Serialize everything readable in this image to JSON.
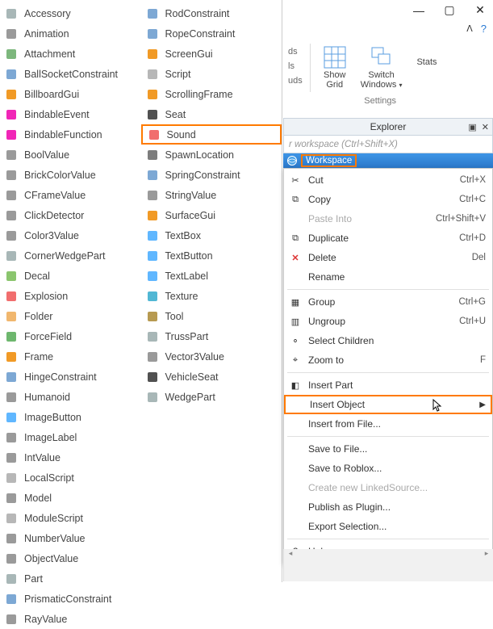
{
  "insert_objects_col1": [
    {
      "label": "Accessory",
      "icon": "#9aa"
    },
    {
      "label": "Animation",
      "icon": "#888"
    },
    {
      "label": "Attachment",
      "icon": "#6a6"
    },
    {
      "label": "BallSocketConstraint",
      "icon": "#69c"
    },
    {
      "label": "BillboardGui",
      "icon": "#e80"
    },
    {
      "label": "BindableEvent",
      "icon": "#e0a"
    },
    {
      "label": "BindableFunction",
      "icon": "#e0a"
    },
    {
      "label": "BoolValue",
      "icon": "#888"
    },
    {
      "label": "BrickColorValue",
      "icon": "#888"
    },
    {
      "label": "CFrameValue",
      "icon": "#888"
    },
    {
      "label": "ClickDetector",
      "icon": "#888"
    },
    {
      "label": "Color3Value",
      "icon": "#888"
    },
    {
      "label": "CornerWedgePart",
      "icon": "#9aa"
    },
    {
      "label": "Decal",
      "icon": "#7b5"
    },
    {
      "label": "Explosion",
      "icon": "#e55"
    },
    {
      "label": "Folder",
      "icon": "#ea5"
    },
    {
      "label": "ForceField",
      "icon": "#5a5"
    },
    {
      "label": "Frame",
      "icon": "#e80"
    },
    {
      "label": "HingeConstraint",
      "icon": "#69c"
    },
    {
      "label": "Humanoid",
      "icon": "#888"
    },
    {
      "label": "ImageButton",
      "icon": "#4af"
    },
    {
      "label": "ImageLabel",
      "icon": "#888"
    },
    {
      "label": "IntValue",
      "icon": "#888"
    },
    {
      "label": "LocalScript",
      "icon": "#aaa"
    },
    {
      "label": "Model",
      "icon": "#888"
    },
    {
      "label": "ModuleScript",
      "icon": "#aaa"
    },
    {
      "label": "NumberValue",
      "icon": "#888"
    },
    {
      "label": "ObjectValue",
      "icon": "#888"
    },
    {
      "label": "Part",
      "icon": "#9aa"
    },
    {
      "label": "PrismaticConstraint",
      "icon": "#69c"
    },
    {
      "label": "RayValue",
      "icon": "#888"
    }
  ],
  "insert_objects_col2": [
    {
      "label": "RodConstraint",
      "icon": "#69c"
    },
    {
      "label": "RopeConstraint",
      "icon": "#69c"
    },
    {
      "label": "ScreenGui",
      "icon": "#e80"
    },
    {
      "label": "Script",
      "icon": "#aaa"
    },
    {
      "label": "ScrollingFrame",
      "icon": "#e80"
    },
    {
      "label": "Seat",
      "icon": "#333"
    },
    {
      "label": "Sound",
      "icon": "#e55",
      "highlight": true
    },
    {
      "label": "SpawnLocation",
      "icon": "#666"
    },
    {
      "label": "SpringConstraint",
      "icon": "#69c"
    },
    {
      "label": "StringValue",
      "icon": "#888"
    },
    {
      "label": "SurfaceGui",
      "icon": "#e80"
    },
    {
      "label": "TextBox",
      "icon": "#4af"
    },
    {
      "label": "TextButton",
      "icon": "#4af"
    },
    {
      "label": "TextLabel",
      "icon": "#4af"
    },
    {
      "label": "Texture",
      "icon": "#3ac"
    },
    {
      "label": "Tool",
      "icon": "#a83"
    },
    {
      "label": "TrussPart",
      "icon": "#9aa"
    },
    {
      "label": "Vector3Value",
      "icon": "#888"
    },
    {
      "label": "VehicleSeat",
      "icon": "#333"
    },
    {
      "label": "WedgePart",
      "icon": "#9aa"
    }
  ],
  "ribbon": {
    "small_labels": [
      "ds",
      "ls",
      "uds"
    ],
    "show_grid": "Show\nGrid",
    "switch_windows": "Switch\nWindows",
    "stats": "Stats",
    "settings_caption": "Settings"
  },
  "explorer": {
    "title": "Explorer",
    "filter_placeholder": "r workspace (Ctrl+Shift+X)",
    "workspace_label": "Workspace"
  },
  "context_menu": [
    {
      "type": "item",
      "label": "Cut",
      "shortcut": "Ctrl+X",
      "icon": "cut"
    },
    {
      "type": "item",
      "label": "Copy",
      "shortcut": "Ctrl+C",
      "icon": "copy"
    },
    {
      "type": "item",
      "label": "Paste Into",
      "shortcut": "Ctrl+Shift+V",
      "disabled": true
    },
    {
      "type": "item",
      "label": "Duplicate",
      "shortcut": "Ctrl+D",
      "icon": "dup"
    },
    {
      "type": "item",
      "label": "Delete",
      "shortcut": "Del",
      "icon": "del"
    },
    {
      "type": "item",
      "label": "Rename"
    },
    {
      "type": "sep"
    },
    {
      "type": "item",
      "label": "Group",
      "shortcut": "Ctrl+G",
      "icon": "grp"
    },
    {
      "type": "item",
      "label": "Ungroup",
      "shortcut": "Ctrl+U",
      "icon": "ugrp"
    },
    {
      "type": "item",
      "label": "Select Children",
      "icon": "sel"
    },
    {
      "type": "item",
      "label": "Zoom to",
      "shortcut": "F",
      "icon": "zoom"
    },
    {
      "type": "sep"
    },
    {
      "type": "item",
      "label": "Insert Part",
      "icon": "part"
    },
    {
      "type": "item",
      "label": "Insert Object",
      "submenu": true,
      "highlight": true,
      "cursor": true
    },
    {
      "type": "item",
      "label": "Insert from File..."
    },
    {
      "type": "sep"
    },
    {
      "type": "item",
      "label": "Save to File..."
    },
    {
      "type": "item",
      "label": "Save to Roblox..."
    },
    {
      "type": "item",
      "label": "Create new LinkedSource...",
      "disabled": true
    },
    {
      "type": "item",
      "label": "Publish as Plugin..."
    },
    {
      "type": "item",
      "label": "Export Selection..."
    },
    {
      "type": "sep"
    },
    {
      "type": "item",
      "label": "Help",
      "icon": "help"
    }
  ]
}
